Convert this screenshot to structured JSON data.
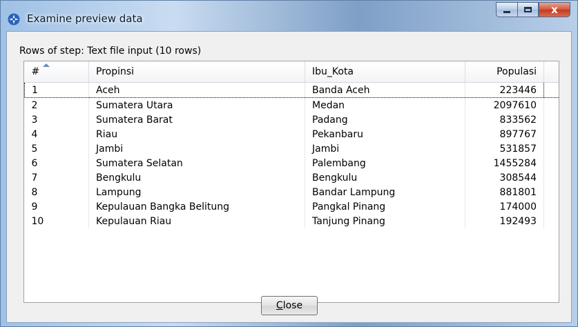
{
  "window": {
    "title": "Examine preview data",
    "app_icon": "kettle-spoon-icon",
    "caption_buttons": {
      "minimize": "minimize-icon",
      "maximize": "maximize-icon",
      "close_glyph": "x"
    }
  },
  "rows_label": "Rows of step: Text file input (10 rows)",
  "table": {
    "columns": [
      "#",
      "Propinsi",
      "Ibu_Kota",
      "Populasi"
    ],
    "rows": [
      {
        "n": "1",
        "propinsi": "Aceh",
        "ibu_kota": "Banda Aceh",
        "populasi": "223446"
      },
      {
        "n": "2",
        "propinsi": "Sumatera Utara",
        "ibu_kota": "Medan",
        "populasi": "2097610"
      },
      {
        "n": "3",
        "propinsi": "Sumatera Barat",
        "ibu_kota": "Padang",
        "populasi": "833562"
      },
      {
        "n": "4",
        "propinsi": "Riau",
        "ibu_kota": "Pekanbaru",
        "populasi": "897767"
      },
      {
        "n": "5",
        "propinsi": "Jambi",
        "ibu_kota": "Jambi",
        "populasi": "531857"
      },
      {
        "n": "6",
        "propinsi": "Sumatera Selatan",
        "ibu_kota": "Palembang",
        "populasi": "1455284"
      },
      {
        "n": "7",
        "propinsi": "Bengkulu",
        "ibu_kota": "Bengkulu",
        "populasi": "308544"
      },
      {
        "n": "8",
        "propinsi": "Lampung",
        "ibu_kota": "Bandar Lampung",
        "populasi": "881801"
      },
      {
        "n": "9",
        "propinsi": "Kepulauan Bangka Belitung",
        "ibu_kota": "Pangkal Pinang",
        "populasi": "174000"
      },
      {
        "n": "10",
        "propinsi": "Kepulauan Riau",
        "ibu_kota": "Tanjung Pinang",
        "populasi": "192493"
      }
    ]
  },
  "buttons": {
    "close_mnemonic": "C",
    "close_rest": "lose"
  },
  "colors": {
    "accent": "#6a8bb7",
    "close_red": "#c33a1f"
  }
}
